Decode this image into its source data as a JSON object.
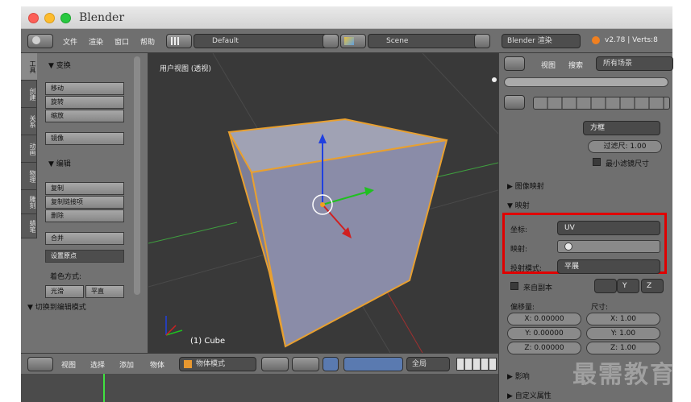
{
  "window": {
    "title": "Blender"
  },
  "topbar": {
    "menu": [
      "文件",
      "渲染",
      "窗口",
      "帮助"
    ],
    "layout_field": "Default",
    "scene_field": "Scene",
    "engine": "Blender 渲染",
    "version": "v2.78 | Verts:8"
  },
  "toolshelf": {
    "tabs": [
      "工具",
      "创建",
      "关系",
      "动画",
      "物理",
      "雕刻",
      "蜡笔"
    ],
    "transform_title": "▼ 变换",
    "transform_buttons": [
      "移动",
      "旋转",
      "缩放"
    ],
    "mirror_button": "镜像",
    "edit_title": "▼ 编辑",
    "edit_buttons": [
      "复制",
      "复制链接项",
      "删除"
    ],
    "join_button": "合并",
    "origin_select": "设置原点",
    "shading_label": "着色方式:",
    "smooth_button": "光滑",
    "flat_button": "平直",
    "toggle_edit": "▼ 切换到编辑模式"
  },
  "viewport": {
    "view_label": "用户视图 (透视)",
    "object_label": "(1) Cube"
  },
  "bottombar": {
    "menu": [
      "视图",
      "选择",
      "添加",
      "物体"
    ],
    "mode": "物体模式",
    "global": "全局"
  },
  "props": {
    "header_menu": [
      "视图",
      "搜索"
    ],
    "scene_filter": "所有场景",
    "filter_type": "方框",
    "filter_size": "过滤尺: 1.00",
    "min_filter": "最小滤镜尺寸",
    "image_mapping": "▶ 图像映射",
    "mapping_title": "▼ 映射",
    "coords_label": "坐标:",
    "coords_value": "UV",
    "map_label": "映射:",
    "projection_label": "投射模式:",
    "projection_value": "平展",
    "from_dupli": "来自副本",
    "x_btn": "Y",
    "z_btn": "Z",
    "offset_label": "偏移量:",
    "size_label": "尺寸:",
    "offset": [
      "X: 0.00000",
      "Y: 0.00000",
      "Z: 0.00000"
    ],
    "size": [
      "X:     1.00",
      "Y:     1.00",
      "Z:     1.00"
    ],
    "influence": "▶ 影响",
    "custom_props": "▶ 自定义属性"
  },
  "watermark": "最需教育",
  "colors": {
    "highlight_box": "#e00000",
    "cube": "#8a8ca8",
    "selection": "#e8a030",
    "x_axis": "#d02020",
    "y_axis": "#20c020",
    "z_axis": "#2040e0"
  }
}
